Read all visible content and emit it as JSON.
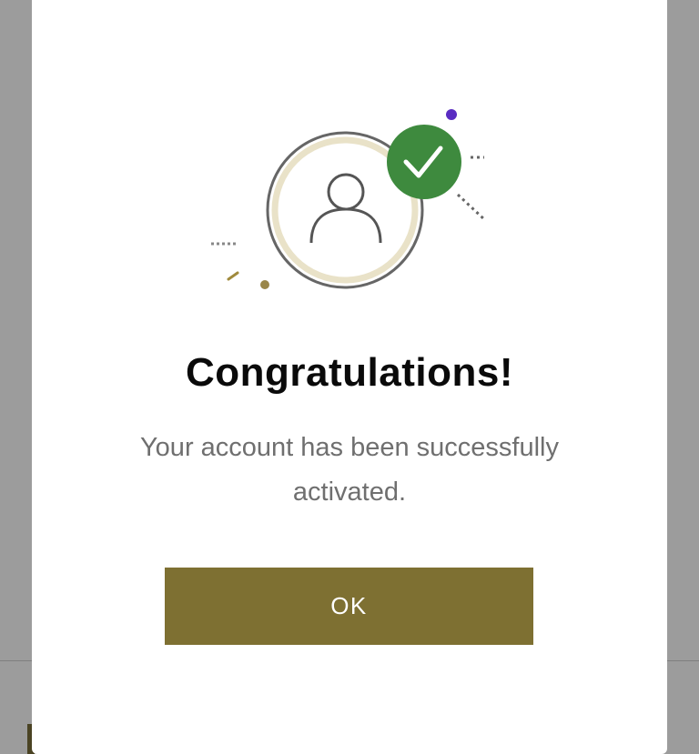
{
  "dialog": {
    "title": "Congratulations!",
    "message": "Your account has been successfully activated.",
    "ok_label": "OK"
  },
  "icons": {
    "avatar": "user-avatar-icon",
    "check": "check-badge-icon"
  },
  "colors": {
    "accent": "#7e7032",
    "success": "#3e8a3e",
    "purple_dot": "#5a2cc2",
    "ring": "#e9e2c8"
  }
}
